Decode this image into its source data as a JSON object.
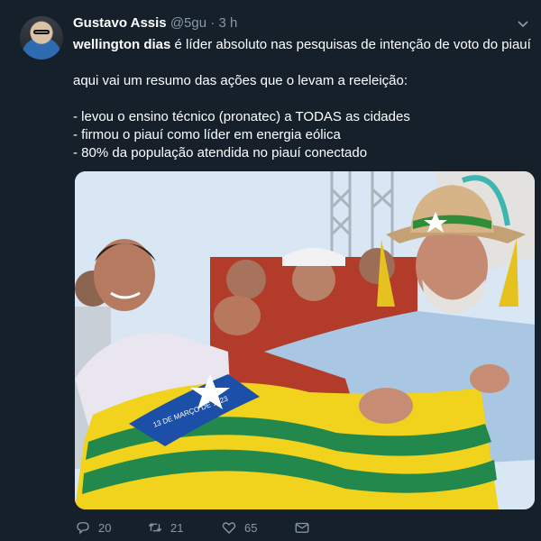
{
  "author": {
    "name": "Gustavo Assis",
    "handle": "@5gu",
    "dot": "·",
    "time": "3 h"
  },
  "tweet": {
    "lead_bold": "wellington dias",
    "lead_rest": " é líder absoluto nas pesquisas de intenção de voto do piauí",
    "summary": "aqui vai um resumo das ações que o levam a reeleição:",
    "bullets": [
      "- levou o ensino técnico (pronatec) a TODAS as cidades",
      "- firmou o piauí como líder em energia eólica",
      "- 80% da população atendida no piauí conectado"
    ]
  },
  "media": {
    "flag_text": "13 DE MARÇO DE 1823"
  },
  "actions": {
    "replies": "20",
    "retweets": "21",
    "likes": "65"
  },
  "icons": [
    "chevron-down-icon",
    "reply-icon",
    "retweet-icon",
    "heart-icon",
    "message-icon"
  ],
  "colors": {
    "background": "#15202b",
    "text": "#ffffff",
    "muted": "#8899a6"
  }
}
